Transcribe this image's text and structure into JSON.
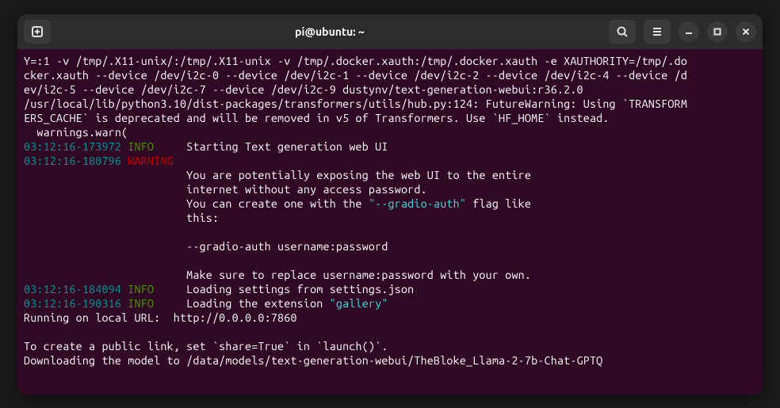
{
  "titlebar": {
    "title": "pi@ubuntu: ~"
  },
  "lines": {
    "l1": "Y=:1 -v /tmp/.X11-unix/:/tmp/.X11-unix -v /tmp/.docker.xauth:/tmp/.docker.xauth -e XAUTHORITY=/tmp/.do",
    "l2": "cker.xauth --device /dev/i2c-0 --device /dev/i2c-1 --device /dev/i2c-2 --device /dev/i2c-4 --device /d",
    "l3": "ev/i2c-5 --device /dev/i2c-7 --device /dev/i2c-9 dustynv/text-generation-webui:r36.2.0",
    "l4": "/usr/local/lib/python3.10/dist-packages/transformers/utils/hub.py:124: FutureWarning: Using `TRANSFORM",
    "l5": "ERS_CACHE` is deprecated and will be removed in v5 of Transformers. Use `HF_HOME` instead.",
    "l6": "  warnings.warn(",
    "ts1": "03:12:16-173972",
    "lv_info": " INFO    ",
    "msg1": " Starting Text generation web UI                                            ",
    "ts2": "03:12:16-180796",
    "lv_warn": " WARNING ",
    "msg2a": "                         You are potentially exposing the web UI to the entire                       ",
    "msg2b": "                         internet without any access password.                                       ",
    "msg2c": "                         You can create one with the ",
    "flag": "\"--gradio-auth\"",
    "msg2c2": " flag like                       ",
    "msg2d": "                         this:                                                                       ",
    "msg2e": "                                                                                                     ",
    "msg2f": "                         --gradio-auth username:password                                             ",
    "msg2g": "                                                                                                     ",
    "msg2h": "                         Make sure to replace username:password with your own.                       ",
    "ts3": "03:12:16-184094",
    "msg3": " Loading settings from settings.json                                        ",
    "ts4": "03:12:16-190316",
    "msg4a": " Loading the extension ",
    "gallery": "\"gallery\"",
    "msg4b": "                                              ",
    "run1": "Running on local URL:  http://0.0.0.0:7860",
    "blank": "",
    "run2": "To create a public link, set `share=True` in `launch()`.",
    "run3": "Downloading the model to /data/models/text-generation-webui/TheBloke_Llama-2-7b-Chat-GPTQ"
  }
}
